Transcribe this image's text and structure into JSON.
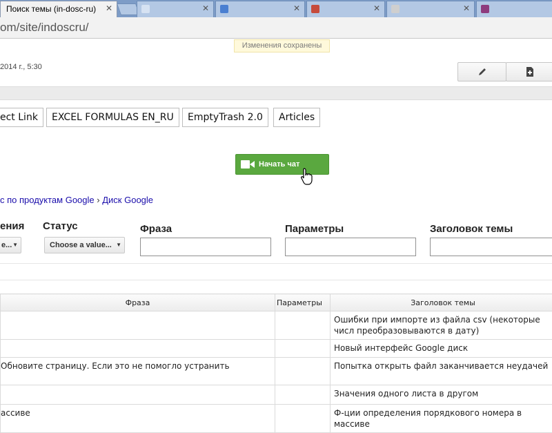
{
  "browser": {
    "active_tab_title": "Поиск темы (in-dosc-ru)",
    "close_glyph": "✕",
    "url_host": "om/site/indoscru/"
  },
  "page": {
    "saved_notice": "Изменения сохранены",
    "timestamp": "2014 г., 5:30",
    "bookmarks": [
      "ect Link",
      "EXCEL FORMULAS EN_RU",
      "EmptyTrash 2.0",
      "Articles"
    ],
    "chat_button": "Начать чат",
    "breadcrumb": {
      "item1": "с по продуктам Google",
      "separator": "›",
      "item2": "Диск Google"
    },
    "filters": {
      "f1_label": "ения",
      "f1_value": "e...",
      "status_label": "Статус",
      "status_value": "Choose a value...",
      "phrase_label": "Фраза",
      "params_label": "Параметры",
      "topic_label": "Заголовок темы"
    }
  },
  "table": {
    "headers": {
      "phrase": "Фраза",
      "params": "Параметры",
      "topic": "Заголовок темы"
    },
    "rows": [
      {
        "phrase": "",
        "params": "",
        "topic": "Ошибки при импорте из файла csv (некоторые числ преобразовываются в дату)"
      },
      {
        "phrase": "",
        "params": "",
        "topic": "Новый интерфейс Google диск"
      },
      {
        "phrase": "Обновите страницу. Если это не помогло устранить",
        "params": "",
        "topic": "Попытка открыть файл заканчивается неудачей"
      },
      {
        "phrase": "",
        "params": "",
        "topic": "Значения одного листа в другом"
      },
      {
        "phrase": "ассиве",
        "params": "",
        "topic": "Ф-ции определения порядкового номера в массиве"
      }
    ]
  },
  "colors": {
    "chat_green": "#5aa83f",
    "link_blue": "#1a0dab",
    "tabstrip_blue": "#7d9cc7"
  }
}
